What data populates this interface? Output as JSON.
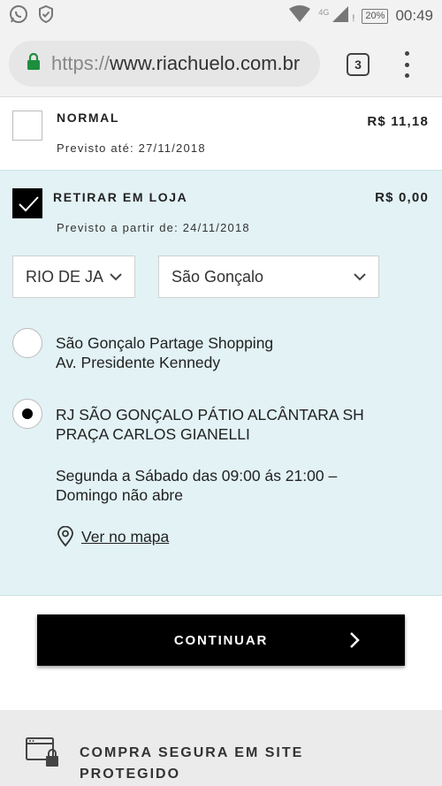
{
  "status_bar": {
    "left_icons": [
      "whatsapp-icon",
      "shield-check-icon"
    ],
    "network_label": "4G",
    "battery": "20%",
    "time": "00:49"
  },
  "browser": {
    "url_scheme": "https://",
    "url_host": "www.riachuelo.com.br",
    "tab_count": "3"
  },
  "shipping": {
    "normal": {
      "title": "NORMAL",
      "price": "R$ 11,18",
      "estimate": "Previsto até: 27/11/2018",
      "checked": false
    },
    "pickup": {
      "title": "RETIRAR EM LOJA",
      "price": "R$ 0,00",
      "estimate": "Previsto a partir de: 24/11/2018",
      "checked": true,
      "state_select": "RIO DE JANEIRO",
      "city_select": "São Gonçalo",
      "stores": [
        {
          "name": "São Gonçalo Partage Shopping",
          "address": "Av. Presidente Kennedy",
          "selected": false
        },
        {
          "name": "RJ SÃO GONÇALO PÁTIO ALCÂNTARA SH",
          "address": "PRAÇA CARLOS GIANELLI",
          "selected": true
        }
      ],
      "hours_line1": "Segunda a Sábado das 09:00 ás 21:00 –",
      "hours_line2": "Domingo não abre",
      "map_link": "Ver no mapa"
    }
  },
  "continue_label": "CONTINUAR",
  "footer": {
    "secure_line1": "COMPRA SEGURA EM SITE",
    "secure_line2": "PROTEGIDO"
  },
  "colors": {
    "panel_bg": "#e2f2f5",
    "url_lock": "#1e8e3e",
    "button_bg": "#000000"
  }
}
